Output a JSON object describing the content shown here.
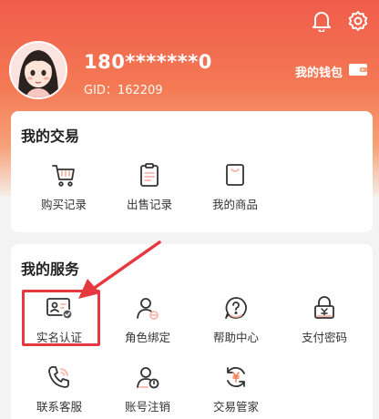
{
  "colors": {
    "accent": "#f05c4b",
    "text": "#333333",
    "highlight": "#e5393f",
    "icon_accent": "#f7b7a9"
  },
  "header": {
    "top_icons": [
      "bell-icon",
      "settings-icon"
    ],
    "user_name": "180*******0",
    "gid_label": "GID：162209",
    "wallet_label": "我的钱包",
    "wallet_icon": "wallet-icon"
  },
  "trade": {
    "title": "我的交易",
    "items": [
      {
        "label": "购买记录",
        "icon": "cart-icon"
      },
      {
        "label": "出售记录",
        "icon": "clipboard-icon"
      },
      {
        "label": "我的商品",
        "icon": "bag-icon"
      }
    ]
  },
  "service": {
    "title": "我的服务",
    "items": [
      {
        "label": "实名认证",
        "icon": "id-card-icon"
      },
      {
        "label": "角色绑定",
        "icon": "user-link-icon"
      },
      {
        "label": "帮助中心",
        "icon": "help-icon"
      },
      {
        "label": "支付密码",
        "icon": "lock-icon"
      },
      {
        "label": "联系客服",
        "icon": "phone-icon"
      },
      {
        "label": "账号注销",
        "icon": "user-off-icon"
      },
      {
        "label": "交易管家",
        "icon": "exchange-icon"
      }
    ]
  }
}
